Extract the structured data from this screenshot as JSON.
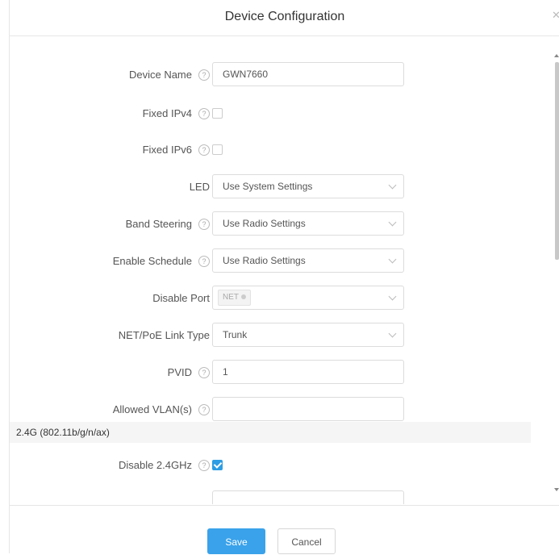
{
  "dialog": {
    "title": "Device Configuration",
    "close_glyph": "✕"
  },
  "form": {
    "device_name": {
      "label": "Device Name",
      "value": "GWN7660"
    },
    "fixed_ipv4": {
      "label": "Fixed IPv4",
      "checked": false
    },
    "fixed_ipv6": {
      "label": "Fixed IPv6",
      "checked": false
    },
    "led": {
      "label": "LED",
      "value": "Use System Settings"
    },
    "band_steering": {
      "label": "Band Steering",
      "value": "Use Radio Settings"
    },
    "enable_schedule": {
      "label": "Enable Schedule",
      "value": "Use Radio Settings"
    },
    "disable_port": {
      "label": "Disable Port",
      "tag": "NET"
    },
    "link_type": {
      "label": "NET/PoE Link Type",
      "value": "Trunk"
    },
    "pvid": {
      "label": "PVID",
      "value": "1"
    },
    "allowed_vlans": {
      "label": "Allowed VLAN(s)",
      "value": ""
    }
  },
  "section_24g": {
    "title": "2.4G (802.11b/g/n/ax)",
    "disable_24ghz": {
      "label": "Disable 2.4GHz",
      "checked": true
    }
  },
  "footer": {
    "save_label": "Save",
    "cancel_label": "Cancel"
  },
  "icons": {
    "help": "?"
  },
  "colors": {
    "primary": "#3aa2ea",
    "checkbox_checked": "#2d9de4"
  }
}
